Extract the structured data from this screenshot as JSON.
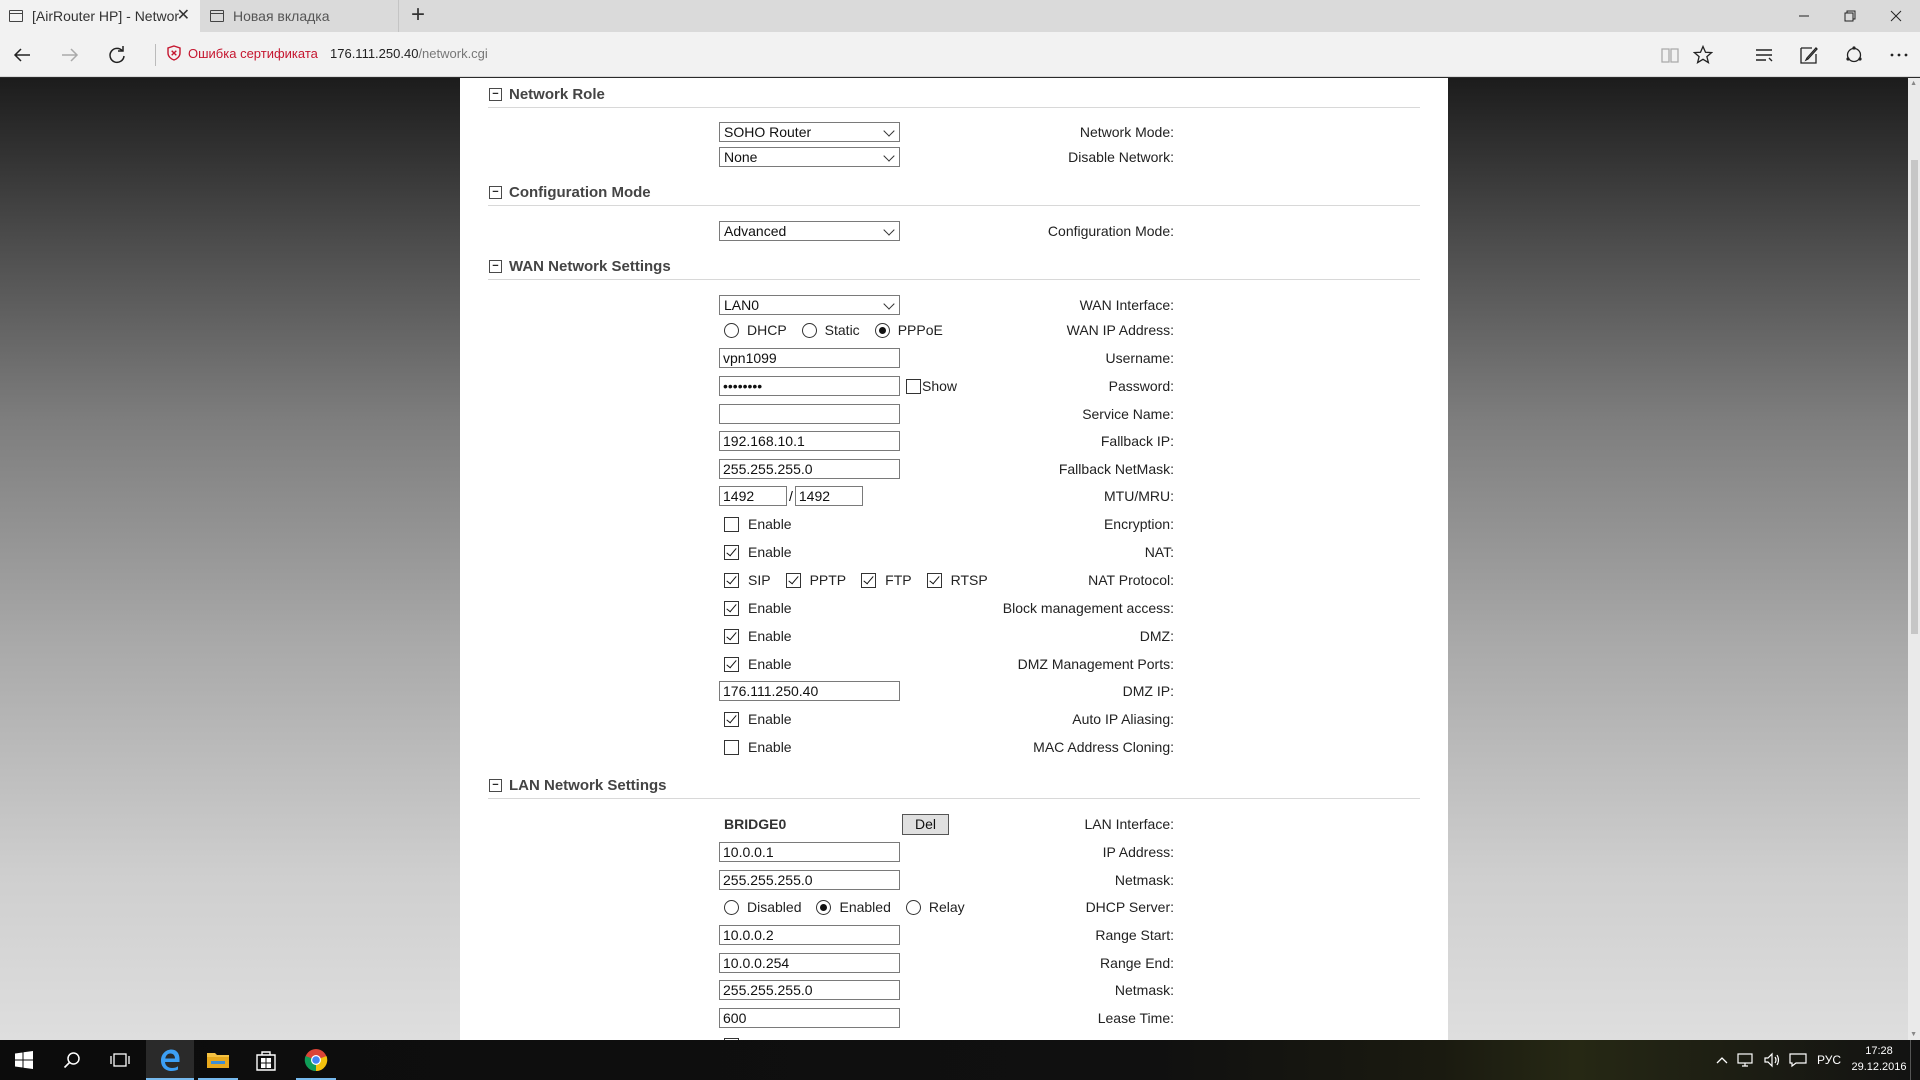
{
  "browser": {
    "tabs": [
      {
        "title": "[AirRouter HP] - Networ",
        "active": true
      },
      {
        "title": "Новая вкладка",
        "active": false
      }
    ],
    "cert_warning": "Ошибка сертификата",
    "url_host": "176.111.250.40",
    "url_path": "/network.cgi"
  },
  "sections": {
    "network_role": "Network Role",
    "configuration_mode": "Configuration Mode",
    "wan": "WAN Network Settings",
    "lan": "LAN Network Settings"
  },
  "network_role": {
    "network_mode_label": "Network Mode:",
    "network_mode_value": "SOHO Router",
    "disable_network_label": "Disable Network:",
    "disable_network_value": "None"
  },
  "configuration": {
    "mode_label": "Configuration Mode:",
    "mode_value": "Advanced"
  },
  "wan": {
    "interface_label": "WAN Interface:",
    "interface_value": "LAN0",
    "ip_label": "WAN IP Address:",
    "ip_options": [
      "DHCP",
      "Static",
      "PPPoE"
    ],
    "ip_selected": "PPPoE",
    "username_label": "Username:",
    "username_value": "vpn1099",
    "password_label": "Password:",
    "password_value": "••••••••",
    "show_label": "Show",
    "service_name_label": "Service Name:",
    "service_name_value": "",
    "fallback_ip_label": "Fallback IP:",
    "fallback_ip_value": "192.168.10.1",
    "fallback_netmask_label": "Fallback NetMask:",
    "fallback_netmask_value": "255.255.255.0",
    "mtu_label": "MTU/MRU:",
    "mtu_value": "1492",
    "mtu_sep": "/",
    "mru_value": "1492",
    "encryption_label": "Encryption:",
    "encryption_checked": false,
    "nat_label": "NAT:",
    "nat_checked": true,
    "nat_protocol_label": "NAT Protocol:",
    "nat_protocols": [
      "SIP",
      "PPTP",
      "FTP",
      "RTSP"
    ],
    "block_mgmt_label": "Block management access:",
    "block_mgmt_checked": true,
    "dmz_label": "DMZ:",
    "dmz_checked": true,
    "dmz_ports_label": "DMZ Management Ports:",
    "dmz_ports_checked": true,
    "dmz_ip_label": "DMZ IP:",
    "dmz_ip_value": "176.111.250.40",
    "auto_ip_label": "Auto IP Aliasing:",
    "auto_ip_checked": true,
    "mac_clone_label": "MAC Address Cloning:",
    "mac_clone_checked": false,
    "enable_text": "Enable"
  },
  "lan": {
    "interface_label": "LAN Interface:",
    "interface_value": "BRIDGE0",
    "del_button": "Del",
    "ip_label": "IP Address:",
    "ip_value": "10.0.0.1",
    "netmask_label": "Netmask:",
    "netmask_value": "255.255.255.0",
    "dhcp_label": "DHCP Server:",
    "dhcp_options": [
      "Disabled",
      "Enabled",
      "Relay"
    ],
    "dhcp_selected": "Enabled",
    "range_start_label": "Range Start:",
    "range_start_value": "10.0.0.2",
    "range_end_label": "Range End:",
    "range_end_value": "10.0.0.254",
    "dhcp_netmask_label": "Netmask:",
    "dhcp_netmask_value": "255.255.255.0",
    "lease_label": "Lease Time:",
    "lease_value": "600"
  },
  "taskbar": {
    "language": "РУС",
    "time": "17:28",
    "date": "29.12.2016"
  },
  "colors": {
    "cert_warning": "#c5162f",
    "edge_blue": "#1e6fc5",
    "taskbar_accent": "#76b9ed"
  }
}
